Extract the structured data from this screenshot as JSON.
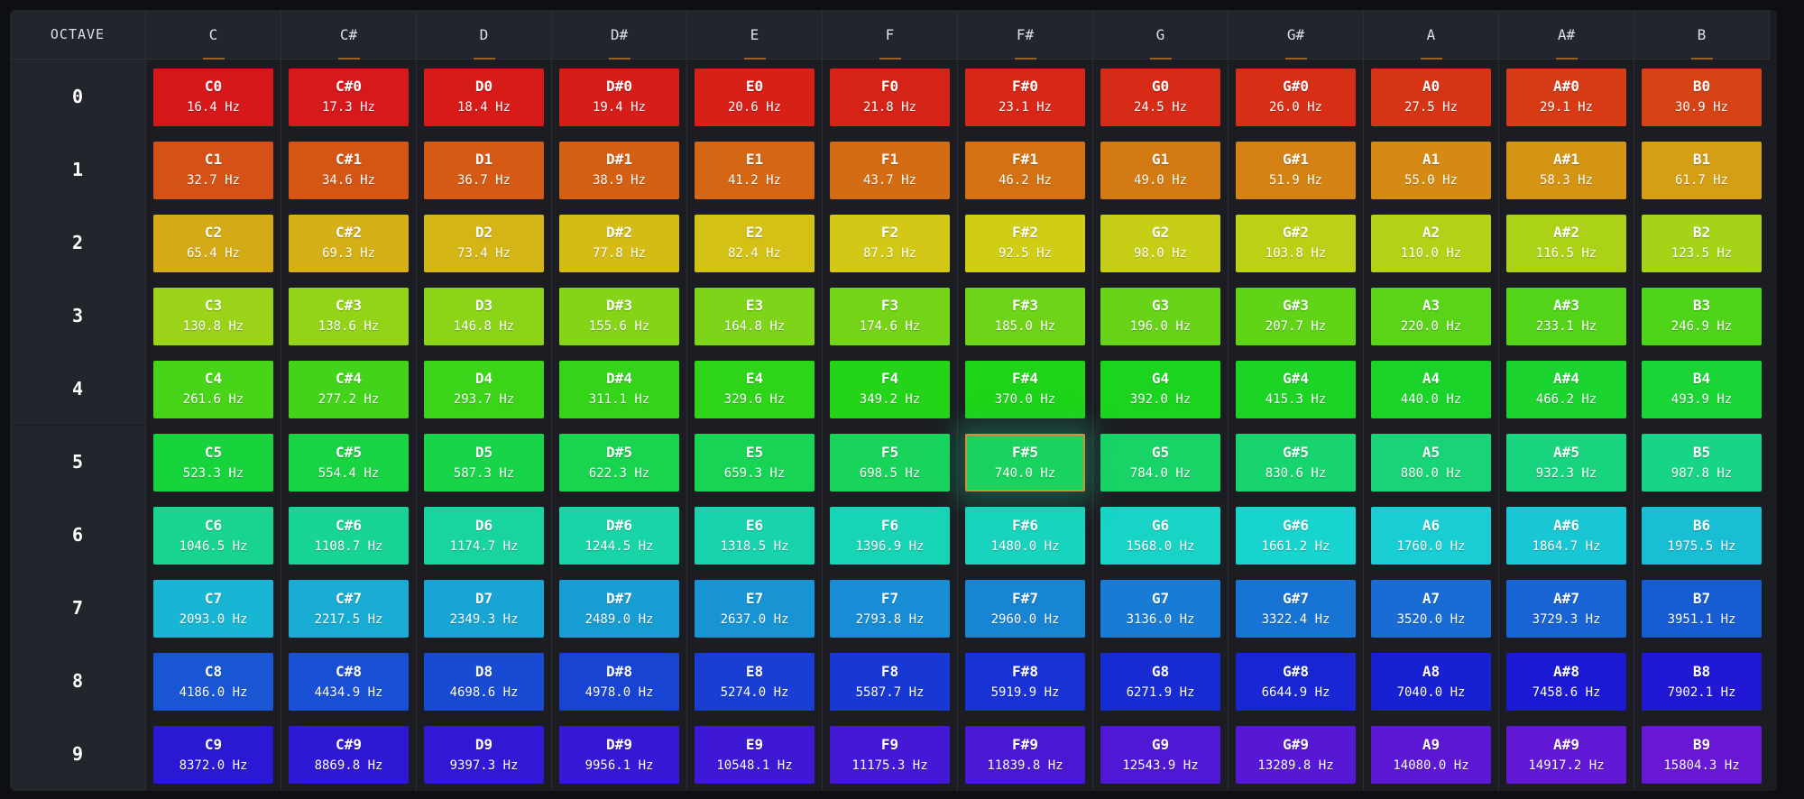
{
  "header": {
    "corner_label": "OCTAVE",
    "notes": [
      "C",
      "C#",
      "D",
      "D#",
      "E",
      "F",
      "F#",
      "G",
      "G#",
      "A",
      "A#",
      "B"
    ]
  },
  "octaves": [
    "0",
    "1",
    "2",
    "3",
    "4",
    "5",
    "6",
    "7",
    "8",
    "9"
  ],
  "active_cell": "F#5",
  "rows": [
    {
      "cells": [
        {
          "note": "C0",
          "freq": "16.4 Hz",
          "color": "#d6181a"
        },
        {
          "note": "C#0",
          "freq": "17.3 Hz",
          "color": "#d6191a"
        },
        {
          "note": "D0",
          "freq": "18.4 Hz",
          "color": "#d61b19"
        },
        {
          "note": "D#0",
          "freq": "19.4 Hz",
          "color": "#d61d18"
        },
        {
          "note": "E0",
          "freq": "20.6 Hz",
          "color": "#d62018"
        },
        {
          "note": "F0",
          "freq": "21.8 Hz",
          "color": "#d62317"
        },
        {
          "note": "F#0",
          "freq": "23.1 Hz",
          "color": "#d62717"
        },
        {
          "note": "G0",
          "freq": "24.5 Hz",
          "color": "#d62b16"
        },
        {
          "note": "G#0",
          "freq": "26.0 Hz",
          "color": "#d62f16"
        },
        {
          "note": "A0",
          "freq": "27.5 Hz",
          "color": "#d63415"
        },
        {
          "note": "A#0",
          "freq": "29.1 Hz",
          "color": "#d63b15"
        },
        {
          "note": "B0",
          "freq": "30.9 Hz",
          "color": "#d64214"
        }
      ]
    },
    {
      "cells": [
        {
          "note": "C1",
          "freq": "32.7 Hz",
          "color": "#d45216"
        },
        {
          "note": "C#1",
          "freq": "34.6 Hz",
          "color": "#d45615"
        },
        {
          "note": "D1",
          "freq": "36.7 Hz",
          "color": "#d45a15"
        },
        {
          "note": "D#1",
          "freq": "38.9 Hz",
          "color": "#d46014"
        },
        {
          "note": "E1",
          "freq": "41.2 Hz",
          "color": "#d46614"
        },
        {
          "note": "F1",
          "freq": "43.7 Hz",
          "color": "#d46c13"
        },
        {
          "note": "F#1",
          "freq": "46.2 Hz",
          "color": "#d47213"
        },
        {
          "note": "G1",
          "freq": "49.0 Hz",
          "color": "#d47a13"
        },
        {
          "note": "G#1",
          "freq": "51.9 Hz",
          "color": "#d48213"
        },
        {
          "note": "A1",
          "freq": "55.0 Hz",
          "color": "#d48a13"
        },
        {
          "note": "A#1",
          "freq": "58.3 Hz",
          "color": "#d49414"
        },
        {
          "note": "B1",
          "freq": "61.7 Hz",
          "color": "#d49e15"
        }
      ]
    },
    {
      "cells": [
        {
          "note": "C2",
          "freq": "65.4 Hz",
          "color": "#d4aa16"
        },
        {
          "note": "C#2",
          "freq": "69.3 Hz",
          "color": "#d4b016"
        },
        {
          "note": "D2",
          "freq": "73.4 Hz",
          "color": "#d4b516"
        },
        {
          "note": "D#2",
          "freq": "77.8 Hz",
          "color": "#d4bb16"
        },
        {
          "note": "E2",
          "freq": "82.4 Hz",
          "color": "#d3c115"
        },
        {
          "note": "F2",
          "freq": "87.3 Hz",
          "color": "#d2c815"
        },
        {
          "note": "F#2",
          "freq": "92.5 Hz",
          "color": "#cfcd15"
        },
        {
          "note": "G2",
          "freq": "98.0 Hz",
          "color": "#c6cf16"
        },
        {
          "note": "G#2",
          "freq": "103.8 Hz",
          "color": "#bcd016"
        },
        {
          "note": "A2",
          "freq": "110.0 Hz",
          "color": "#b4d117"
        },
        {
          "note": "A#2",
          "freq": "116.5 Hz",
          "color": "#acd217"
        },
        {
          "note": "B2",
          "freq": "123.5 Hz",
          "color": "#a4d317"
        }
      ]
    },
    {
      "cells": [
        {
          "note": "C3",
          "freq": "130.8 Hz",
          "color": "#9ad318"
        },
        {
          "note": "C#3",
          "freq": "138.6 Hz",
          "color": "#93d418"
        },
        {
          "note": "D3",
          "freq": "146.8 Hz",
          "color": "#8cd418"
        },
        {
          "note": "D#3",
          "freq": "155.6 Hz",
          "color": "#85d418"
        },
        {
          "note": "E3",
          "freq": "164.8 Hz",
          "color": "#7dd418"
        },
        {
          "note": "F3",
          "freq": "174.6 Hz",
          "color": "#76d418"
        },
        {
          "note": "F#3",
          "freq": "185.0 Hz",
          "color": "#6fd418"
        },
        {
          "note": "G3",
          "freq": "196.0 Hz",
          "color": "#68d418"
        },
        {
          "note": "G#3",
          "freq": "207.7 Hz",
          "color": "#61d418"
        },
        {
          "note": "A3",
          "freq": "220.0 Hz",
          "color": "#5ad418"
        },
        {
          "note": "A#3",
          "freq": "233.1 Hz",
          "color": "#54d418"
        },
        {
          "note": "B3",
          "freq": "246.9 Hz",
          "color": "#4ed418"
        }
      ]
    },
    {
      "cells": [
        {
          "note": "C4",
          "freq": "261.6 Hz",
          "color": "#48d418"
        },
        {
          "note": "C#4",
          "freq": "277.2 Hz",
          "color": "#42d418"
        },
        {
          "note": "D4",
          "freq": "293.7 Hz",
          "color": "#3cd418"
        },
        {
          "note": "D#4",
          "freq": "311.1 Hz",
          "color": "#34d418"
        },
        {
          "note": "E4",
          "freq": "329.6 Hz",
          "color": "#2dd418"
        },
        {
          "note": "F4",
          "freq": "349.2 Hz",
          "color": "#24d418"
        },
        {
          "note": "F#4",
          "freq": "370.0 Hz",
          "color": "#1ed418"
        },
        {
          "note": "G4",
          "freq": "392.0 Hz",
          "color": "#1bd41e"
        },
        {
          "note": "G#4",
          "freq": "415.3 Hz",
          "color": "#1bd424"
        },
        {
          "note": "A4",
          "freq": "440.0 Hz",
          "color": "#1bd42a"
        },
        {
          "note": "A#4",
          "freq": "466.2 Hz",
          "color": "#1bd430"
        },
        {
          "note": "B4",
          "freq": "493.9 Hz",
          "color": "#1bd436"
        }
      ]
    },
    {
      "cells": [
        {
          "note": "C5",
          "freq": "523.3 Hz",
          "color": "#18d43c"
        },
        {
          "note": "C#5",
          "freq": "554.4 Hz",
          "color": "#18d442"
        },
        {
          "note": "D5",
          "freq": "587.3 Hz",
          "color": "#18d448"
        },
        {
          "note": "D#5",
          "freq": "622.3 Hz",
          "color": "#18d44e"
        },
        {
          "note": "E5",
          "freq": "659.3 Hz",
          "color": "#18d454"
        },
        {
          "note": "F5",
          "freq": "698.5 Hz",
          "color": "#18d45a"
        },
        {
          "note": "F#5",
          "freq": "740.0 Hz",
          "color": "#18d45f"
        },
        {
          "note": "G5",
          "freq": "784.0 Hz",
          "color": "#18d466"
        },
        {
          "note": "G#5",
          "freq": "830.6 Hz",
          "color": "#18d46e"
        },
        {
          "note": "A5",
          "freq": "880.0 Hz",
          "color": "#18d476"
        },
        {
          "note": "A#5",
          "freq": "932.3 Hz",
          "color": "#18d47e"
        },
        {
          "note": "B5",
          "freq": "987.8 Hz",
          "color": "#18d486"
        }
      ]
    },
    {
      "cells": [
        {
          "note": "C6",
          "freq": "1046.5 Hz",
          "color": "#18d48e"
        },
        {
          "note": "C#6",
          "freq": "1108.7 Hz",
          "color": "#18d496"
        },
        {
          "note": "D6",
          "freq": "1174.7 Hz",
          "color": "#18d49e"
        },
        {
          "note": "D#6",
          "freq": "1244.5 Hz",
          "color": "#18d4a6"
        },
        {
          "note": "E6",
          "freq": "1318.5 Hz",
          "color": "#18d4ae"
        },
        {
          "note": "F6",
          "freq": "1396.9 Hz",
          "color": "#18d4b6"
        },
        {
          "note": "F#6",
          "freq": "1480.0 Hz",
          "color": "#18d4be"
        },
        {
          "note": "G6",
          "freq": "1568.0 Hz",
          "color": "#18d4c6"
        },
        {
          "note": "G#6",
          "freq": "1661.2 Hz",
          "color": "#18d4ce"
        },
        {
          "note": "A6",
          "freq": "1760.0 Hz",
          "color": "#18ced4"
        },
        {
          "note": "A#6",
          "freq": "1864.7 Hz",
          "color": "#18c6d4"
        },
        {
          "note": "B6",
          "freq": "1975.5 Hz",
          "color": "#18bed4"
        }
      ]
    },
    {
      "cells": [
        {
          "note": "C7",
          "freq": "2093.0 Hz",
          "color": "#18b6d4"
        },
        {
          "note": "C#7",
          "freq": "2217.5 Hz",
          "color": "#18acd4"
        },
        {
          "note": "D7",
          "freq": "2349.3 Hz",
          "color": "#18a4d4"
        },
        {
          "note": "D#7",
          "freq": "2489.0 Hz",
          "color": "#189cd4"
        },
        {
          "note": "E7",
          "freq": "2637.0 Hz",
          "color": "#1894d4"
        },
        {
          "note": "F7",
          "freq": "2793.8 Hz",
          "color": "#188cd4"
        },
        {
          "note": "F#7",
          "freq": "2960.0 Hz",
          "color": "#1884d4"
        },
        {
          "note": "G7",
          "freq": "3136.0 Hz",
          "color": "#187cd4"
        },
        {
          "note": "G#7",
          "freq": "3322.4 Hz",
          "color": "#1874d4"
        },
        {
          "note": "A7",
          "freq": "3520.0 Hz",
          "color": "#186cd4"
        },
        {
          "note": "A#7",
          "freq": "3729.3 Hz",
          "color": "#1864d4"
        },
        {
          "note": "B7",
          "freq": "3951.1 Hz",
          "color": "#185cd4"
        }
      ]
    },
    {
      "cells": [
        {
          "note": "C8",
          "freq": "4186.0 Hz",
          "color": "#1856d4"
        },
        {
          "note": "C#8",
          "freq": "4434.9 Hz",
          "color": "#1850d4"
        },
        {
          "note": "D8",
          "freq": "4698.6 Hz",
          "color": "#184ad4"
        },
        {
          "note": "D#8",
          "freq": "4978.0 Hz",
          "color": "#1844d4"
        },
        {
          "note": "E8",
          "freq": "5274.0 Hz",
          "color": "#183ed4"
        },
        {
          "note": "F8",
          "freq": "5587.7 Hz",
          "color": "#1838d4"
        },
        {
          "note": "F#8",
          "freq": "5919.9 Hz",
          "color": "#1832d4"
        },
        {
          "note": "G8",
          "freq": "6271.9 Hz",
          "color": "#182cd4"
        },
        {
          "note": "G#8",
          "freq": "6644.9 Hz",
          "color": "#1826d4"
        },
        {
          "note": "A8",
          "freq": "7040.0 Hz",
          "color": "#1820d4"
        },
        {
          "note": "A#8",
          "freq": "7458.6 Hz",
          "color": "#1a1ad4"
        },
        {
          "note": "B8",
          "freq": "7902.1 Hz",
          "color": "#2018d4"
        }
      ]
    },
    {
      "cells": [
        {
          "note": "C9",
          "freq": "8372.0 Hz",
          "color": "#2a18d4"
        },
        {
          "note": "C#9",
          "freq": "8869.8 Hz",
          "color": "#2e18d4"
        },
        {
          "note": "D9",
          "freq": "9397.3 Hz",
          "color": "#3218d4"
        },
        {
          "note": "D#9",
          "freq": "9956.1 Hz",
          "color": "#3818d4"
        },
        {
          "note": "E9",
          "freq": "10548.1 Hz",
          "color": "#3e18d4"
        },
        {
          "note": "F9",
          "freq": "11175.3 Hz",
          "color": "#4418d4"
        },
        {
          "note": "F#9",
          "freq": "11839.8 Hz",
          "color": "#4a18d4"
        },
        {
          "note": "G9",
          "freq": "12543.9 Hz",
          "color": "#5018d4"
        },
        {
          "note": "G#9",
          "freq": "13289.8 Hz",
          "color": "#5618d4"
        },
        {
          "note": "A9",
          "freq": "14080.0 Hz",
          "color": "#5c18d4"
        },
        {
          "note": "A#9",
          "freq": "14917.2 Hz",
          "color": "#6218d4"
        },
        {
          "note": "B9",
          "freq": "15804.3 Hz",
          "color": "#6818d4"
        }
      ]
    }
  ]
}
